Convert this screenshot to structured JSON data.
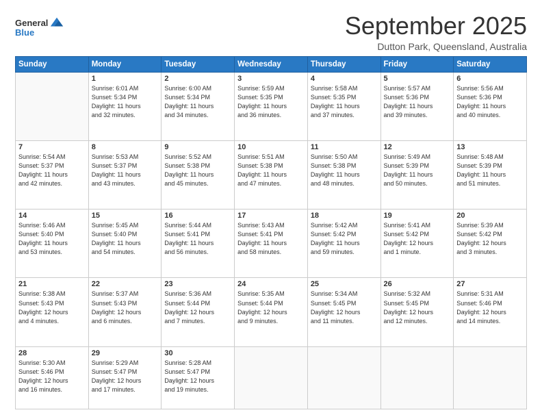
{
  "header": {
    "logo_line1": "General",
    "logo_line2": "Blue",
    "month": "September 2025",
    "location": "Dutton Park, Queensland, Australia"
  },
  "weekdays": [
    "Sunday",
    "Monday",
    "Tuesday",
    "Wednesday",
    "Thursday",
    "Friday",
    "Saturday"
  ],
  "weeks": [
    [
      {
        "day": "",
        "info": ""
      },
      {
        "day": "1",
        "info": "Sunrise: 6:01 AM\nSunset: 5:34 PM\nDaylight: 11 hours\nand 32 minutes."
      },
      {
        "day": "2",
        "info": "Sunrise: 6:00 AM\nSunset: 5:34 PM\nDaylight: 11 hours\nand 34 minutes."
      },
      {
        "day": "3",
        "info": "Sunrise: 5:59 AM\nSunset: 5:35 PM\nDaylight: 11 hours\nand 36 minutes."
      },
      {
        "day": "4",
        "info": "Sunrise: 5:58 AM\nSunset: 5:35 PM\nDaylight: 11 hours\nand 37 minutes."
      },
      {
        "day": "5",
        "info": "Sunrise: 5:57 AM\nSunset: 5:36 PM\nDaylight: 11 hours\nand 39 minutes."
      },
      {
        "day": "6",
        "info": "Sunrise: 5:56 AM\nSunset: 5:36 PM\nDaylight: 11 hours\nand 40 minutes."
      }
    ],
    [
      {
        "day": "7",
        "info": "Sunrise: 5:54 AM\nSunset: 5:37 PM\nDaylight: 11 hours\nand 42 minutes."
      },
      {
        "day": "8",
        "info": "Sunrise: 5:53 AM\nSunset: 5:37 PM\nDaylight: 11 hours\nand 43 minutes."
      },
      {
        "day": "9",
        "info": "Sunrise: 5:52 AM\nSunset: 5:38 PM\nDaylight: 11 hours\nand 45 minutes."
      },
      {
        "day": "10",
        "info": "Sunrise: 5:51 AM\nSunset: 5:38 PM\nDaylight: 11 hours\nand 47 minutes."
      },
      {
        "day": "11",
        "info": "Sunrise: 5:50 AM\nSunset: 5:38 PM\nDaylight: 11 hours\nand 48 minutes."
      },
      {
        "day": "12",
        "info": "Sunrise: 5:49 AM\nSunset: 5:39 PM\nDaylight: 11 hours\nand 50 minutes."
      },
      {
        "day": "13",
        "info": "Sunrise: 5:48 AM\nSunset: 5:39 PM\nDaylight: 11 hours\nand 51 minutes."
      }
    ],
    [
      {
        "day": "14",
        "info": "Sunrise: 5:46 AM\nSunset: 5:40 PM\nDaylight: 11 hours\nand 53 minutes."
      },
      {
        "day": "15",
        "info": "Sunrise: 5:45 AM\nSunset: 5:40 PM\nDaylight: 11 hours\nand 54 minutes."
      },
      {
        "day": "16",
        "info": "Sunrise: 5:44 AM\nSunset: 5:41 PM\nDaylight: 11 hours\nand 56 minutes."
      },
      {
        "day": "17",
        "info": "Sunrise: 5:43 AM\nSunset: 5:41 PM\nDaylight: 11 hours\nand 58 minutes."
      },
      {
        "day": "18",
        "info": "Sunrise: 5:42 AM\nSunset: 5:42 PM\nDaylight: 11 hours\nand 59 minutes."
      },
      {
        "day": "19",
        "info": "Sunrise: 5:41 AM\nSunset: 5:42 PM\nDaylight: 12 hours\nand 1 minute."
      },
      {
        "day": "20",
        "info": "Sunrise: 5:39 AM\nSunset: 5:42 PM\nDaylight: 12 hours\nand 3 minutes."
      }
    ],
    [
      {
        "day": "21",
        "info": "Sunrise: 5:38 AM\nSunset: 5:43 PM\nDaylight: 12 hours\nand 4 minutes."
      },
      {
        "day": "22",
        "info": "Sunrise: 5:37 AM\nSunset: 5:43 PM\nDaylight: 12 hours\nand 6 minutes."
      },
      {
        "day": "23",
        "info": "Sunrise: 5:36 AM\nSunset: 5:44 PM\nDaylight: 12 hours\nand 7 minutes."
      },
      {
        "day": "24",
        "info": "Sunrise: 5:35 AM\nSunset: 5:44 PM\nDaylight: 12 hours\nand 9 minutes."
      },
      {
        "day": "25",
        "info": "Sunrise: 5:34 AM\nSunset: 5:45 PM\nDaylight: 12 hours\nand 11 minutes."
      },
      {
        "day": "26",
        "info": "Sunrise: 5:32 AM\nSunset: 5:45 PM\nDaylight: 12 hours\nand 12 minutes."
      },
      {
        "day": "27",
        "info": "Sunrise: 5:31 AM\nSunset: 5:46 PM\nDaylight: 12 hours\nand 14 minutes."
      }
    ],
    [
      {
        "day": "28",
        "info": "Sunrise: 5:30 AM\nSunset: 5:46 PM\nDaylight: 12 hours\nand 16 minutes."
      },
      {
        "day": "29",
        "info": "Sunrise: 5:29 AM\nSunset: 5:47 PM\nDaylight: 12 hours\nand 17 minutes."
      },
      {
        "day": "30",
        "info": "Sunrise: 5:28 AM\nSunset: 5:47 PM\nDaylight: 12 hours\nand 19 minutes."
      },
      {
        "day": "",
        "info": ""
      },
      {
        "day": "",
        "info": ""
      },
      {
        "day": "",
        "info": ""
      },
      {
        "day": "",
        "info": ""
      }
    ]
  ]
}
